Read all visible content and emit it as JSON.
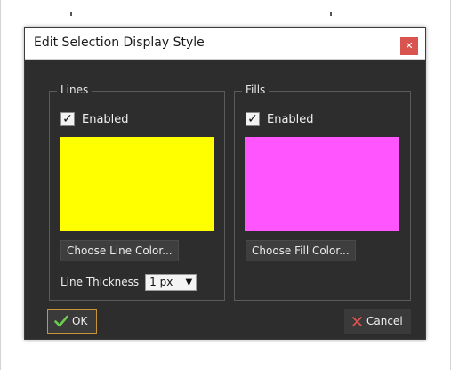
{
  "dialog": {
    "title": "Edit Selection Display Style",
    "close_icon": "close-icon"
  },
  "lines": {
    "legend": "Lines",
    "enabled_label": "Enabled",
    "enabled_checked": true,
    "color": "#ffff00",
    "choose_color_label": "Choose Line Color...",
    "thickness_label": "Line Thickness",
    "thickness_value": "1 px"
  },
  "fills": {
    "legend": "Fills",
    "enabled_label": "Enabled",
    "enabled_checked": true,
    "color": "#ff55ff",
    "choose_color_label": "Choose Fill Color..."
  },
  "buttons": {
    "ok_label": "OK",
    "ok_icon": "check-icon",
    "ok_icon_color": "#6ccc4e",
    "cancel_label": "Cancel",
    "cancel_icon": "x-icon",
    "cancel_icon_color": "#d9534f",
    "close_button_color": "#d9534f"
  }
}
